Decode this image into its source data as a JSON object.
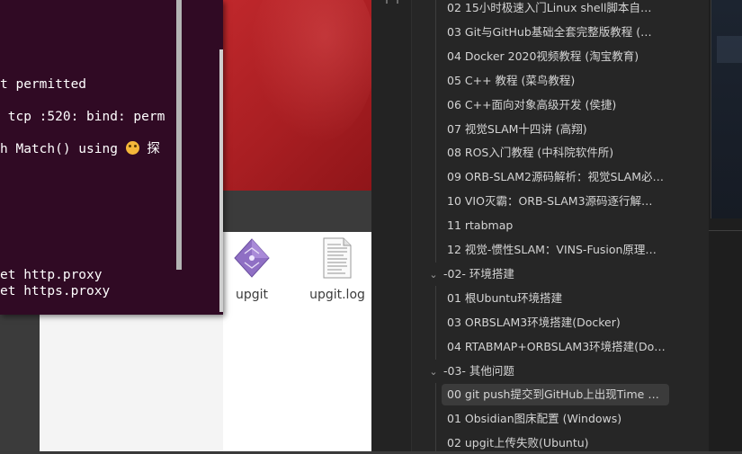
{
  "terminal": {
    "lines": [
      "t permitted",
      " tcp :520: bind: perm",
      "h Match() using ",
      "et http.proxy",
      "et https.proxy"
    ],
    "emoji_tail": "探"
  },
  "file_manager": {
    "files": [
      {
        "name": "upgit",
        "icon": "executable-diamond-icon"
      },
      {
        "name": "upgit.log",
        "icon": "text-file-icon"
      }
    ]
  },
  "obsidian": {
    "tree": [
      {
        "type": "file",
        "label": "02 15小时极速入门Linux shell脚本自…"
      },
      {
        "type": "file",
        "label": "03 Git与GitHub基础全套完整版教程 (…"
      },
      {
        "type": "file",
        "label": "04 Docker 2020视频教程 (淘宝教育)"
      },
      {
        "type": "file",
        "label": "05 C++ 教程 (菜鸟教程)"
      },
      {
        "type": "file",
        "label": "06 C++面向对象高级开发 (侯捷)"
      },
      {
        "type": "file",
        "label": "07 视觉SLAM十四讲 (高翔)"
      },
      {
        "type": "file",
        "label": "08 ROS入门教程 (中科院软件所)"
      },
      {
        "type": "file",
        "label": "09 ORB-SLAM2源码解析：视觉SLAM必…"
      },
      {
        "type": "file",
        "label": "10 VIO灭霸：ORB-SLAM3源码逐行解…"
      },
      {
        "type": "file",
        "label": "11 rtabmap"
      },
      {
        "type": "file",
        "label": "12 视觉-惯性SLAM：VINS-Fusion原理…"
      },
      {
        "type": "folder",
        "label": "-02- 环境搭建"
      },
      {
        "type": "file",
        "label": "01 根Ubuntu环境搭建"
      },
      {
        "type": "file",
        "label": "03 ORBSLAM3环境搭建(Docker)"
      },
      {
        "type": "file",
        "label": "04 RTABMAP+ORBSLAM3环境搭建(Do…"
      },
      {
        "type": "folder",
        "label": "-03- 其他问题"
      },
      {
        "type": "file",
        "label": "00 git push提交到GitHub上出现Time …",
        "active": true
      },
      {
        "type": "file",
        "label": "01 Obsidian图床配置 (Windows)"
      },
      {
        "type": "file",
        "label": "02 upgit上传失败(Ubuntu)"
      }
    ]
  },
  "colors": {
    "terminal_bg": "#300a24",
    "sidebar_bg": "#262626",
    "active_row": "#3b3b3b"
  }
}
